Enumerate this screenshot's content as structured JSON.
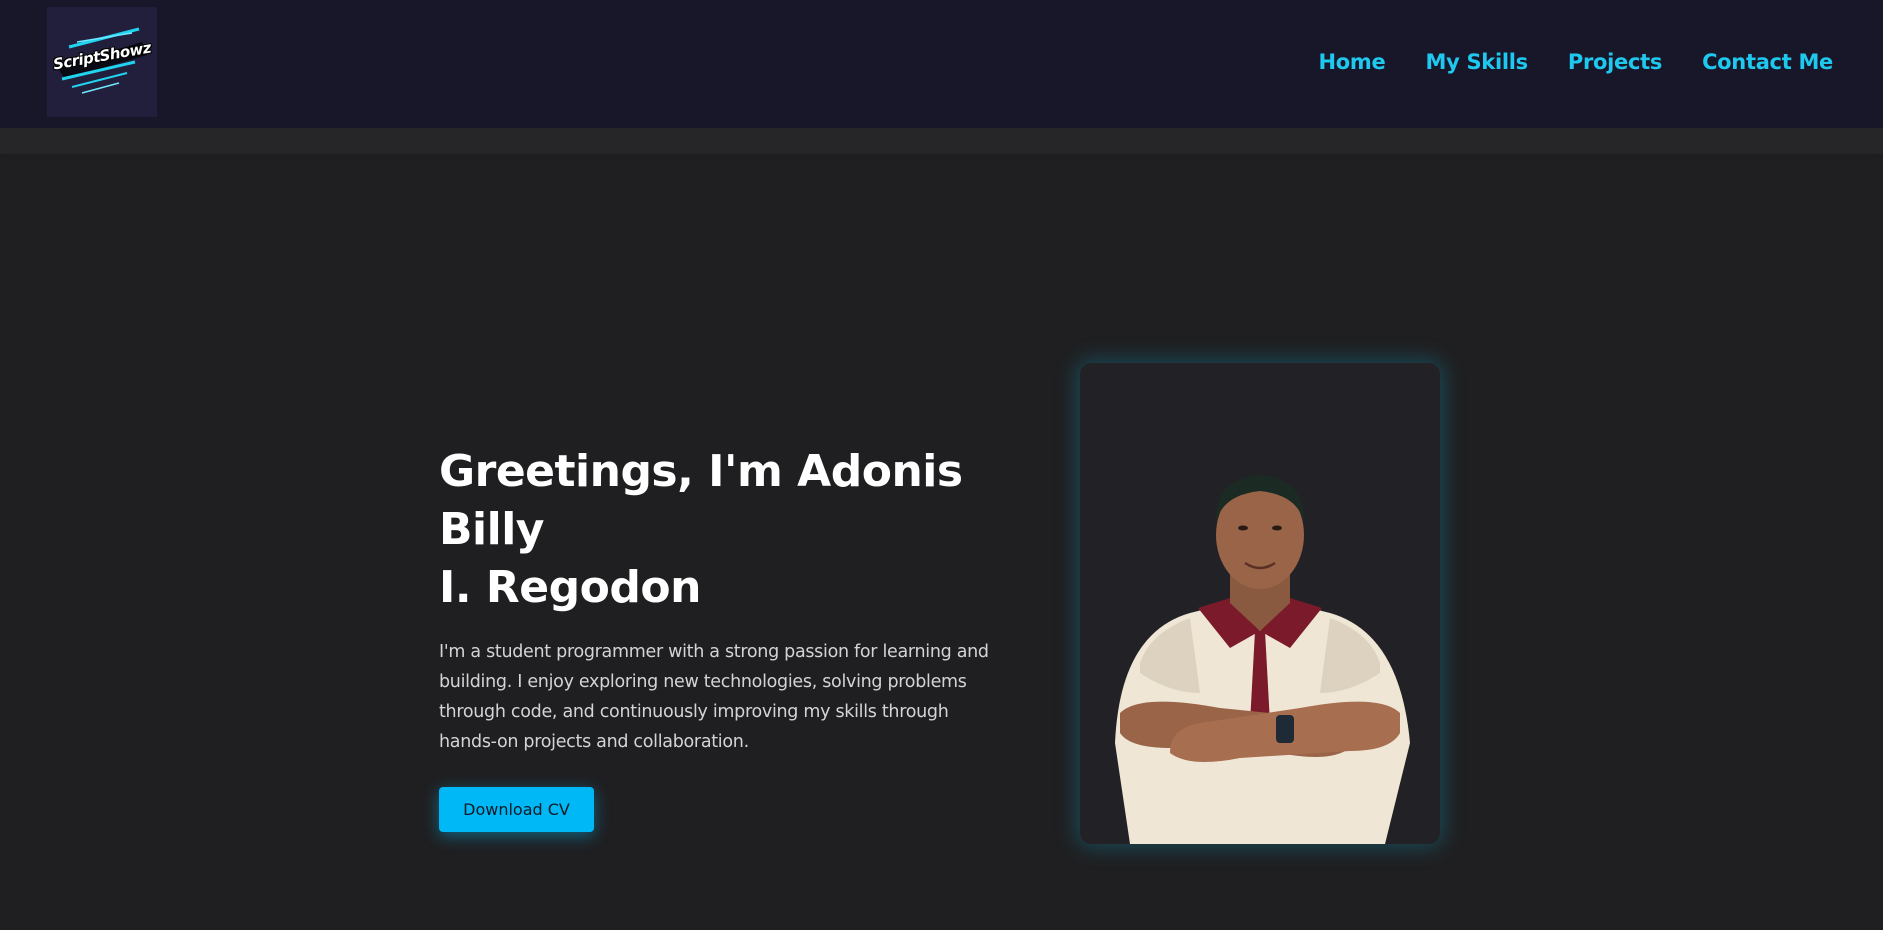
{
  "brand": {
    "logo_text": "ScriptShowz"
  },
  "nav": {
    "items": [
      {
        "label": "Home"
      },
      {
        "label": "My Skills"
      },
      {
        "label": "Projects"
      },
      {
        "label": "Contact Me"
      }
    ]
  },
  "hero": {
    "title_line1": "Greetings, I'm Adonis Billy",
    "title_line2": "I. Regodon",
    "description": "I'm a student programmer with a strong passion for learning and building. I enjoy exploring new technologies, solving problems through code, and continuously improving my skills through hands-on projects and collaboration.",
    "cta_label": "Download CV"
  },
  "colors": {
    "accent": "#1ec8ef",
    "button": "#00b8f5",
    "navbar_bg": "#18172a",
    "page_bg": "#1f1f21"
  }
}
